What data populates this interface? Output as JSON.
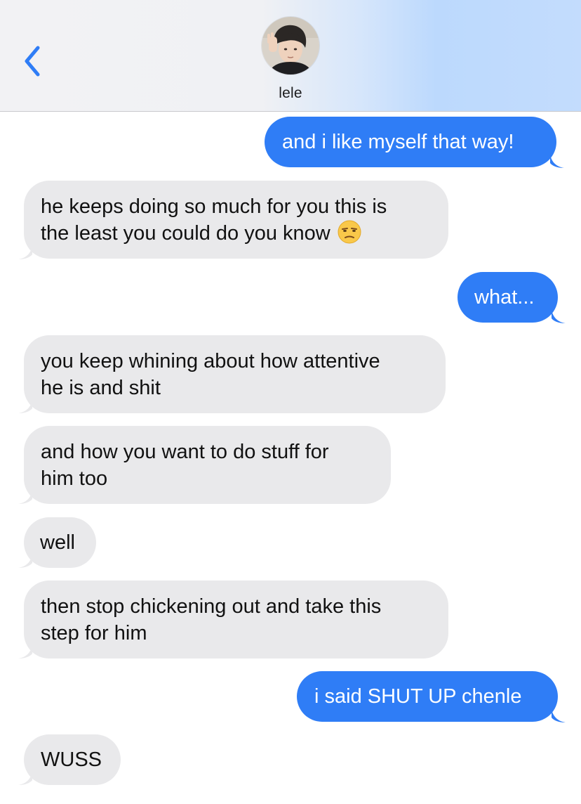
{
  "header": {
    "back_icon": "chevron-left-icon",
    "contact_name": "lele",
    "accent_color": "#2f7df6"
  },
  "messages": [
    {
      "direction": "sent",
      "lines": [
        "and i like myself that way!"
      ]
    },
    {
      "direction": "received",
      "lines": [
        "he keeps doing so much for you this is",
        "the least you could do you know"
      ],
      "emoji": "unamused-face-icon"
    },
    {
      "direction": "sent",
      "lines": [
        "what..."
      ]
    },
    {
      "direction": "received",
      "lines": [
        "you keep whining about how attentive",
        "he is and shit"
      ]
    },
    {
      "direction": "received",
      "lines": [
        "and how you want to do stuff for",
        "him too"
      ]
    },
    {
      "direction": "received",
      "lines": [
        "well"
      ]
    },
    {
      "direction": "received",
      "lines": [
        "then stop chickening out and take this",
        "step for him"
      ]
    },
    {
      "direction": "sent",
      "lines": [
        "i said SHUT UP chenle"
      ]
    },
    {
      "direction": "received",
      "lines": [
        "WUSS"
      ]
    }
  ],
  "colors": {
    "sent_bubble": "#2f7df6",
    "received_bubble": "#e9e9eb"
  }
}
